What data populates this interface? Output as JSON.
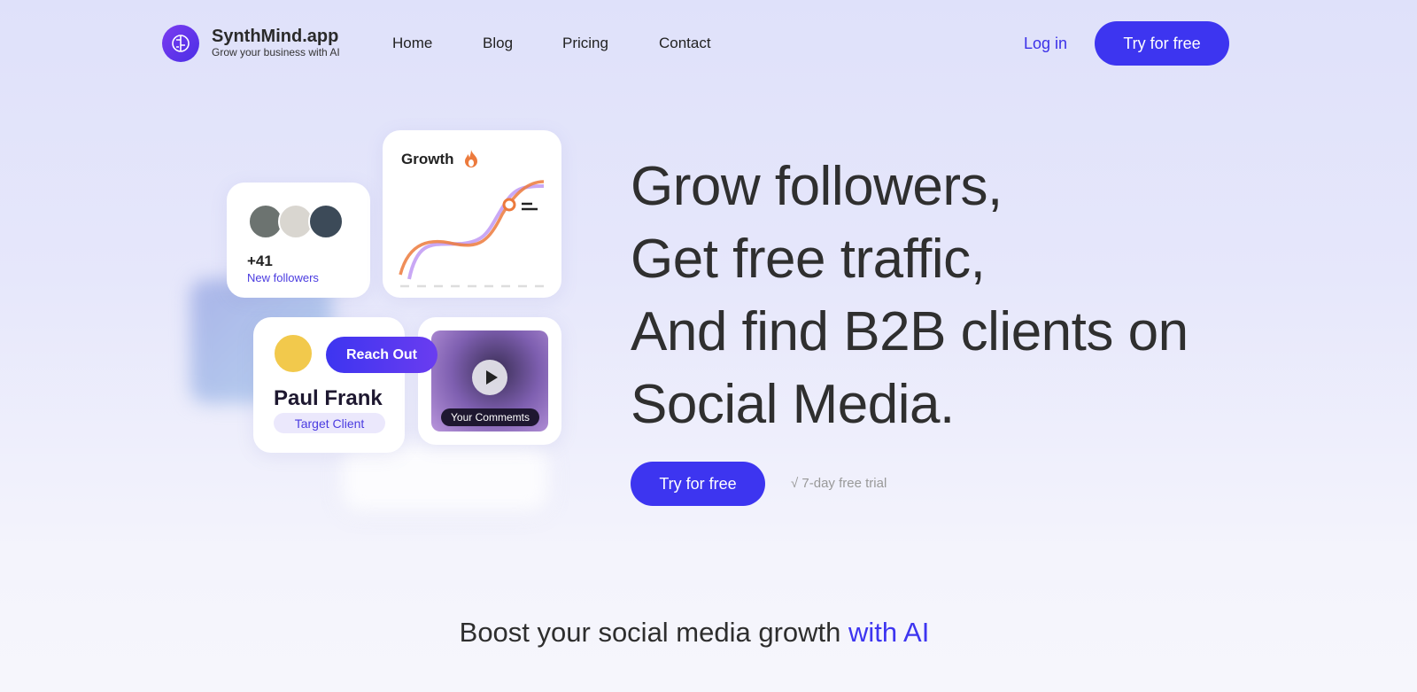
{
  "brand": {
    "name": "SynthMind.app",
    "tagline": "Grow your business with AI",
    "logo_icon": "brain-gear-icon"
  },
  "nav": {
    "items": [
      "Home",
      "Blog",
      "Pricing",
      "Contact"
    ],
    "login": "Log in",
    "cta": "Try for free"
  },
  "cards": {
    "followers": {
      "count": "+41",
      "label": "New followers"
    },
    "growth": {
      "title": "Growth",
      "icon": "fire-icon"
    },
    "client": {
      "name": "Paul Frank",
      "badge": "Target Client",
      "action": "Reach Out"
    },
    "video": {
      "label": "Your Commemts",
      "icon": "play-icon"
    }
  },
  "hero": {
    "lines": [
      "Grow followers,",
      "Get free traffic,",
      "And find B2B clients on",
      "Social Media."
    ],
    "cta": "Try for free",
    "note": "√ 7-day free trial"
  },
  "section": {
    "heading": "Boost your social media growth ",
    "heading_accent": "with AI"
  },
  "colors": {
    "accent": "#3d35f0",
    "orange": "#ec7a3c",
    "lavender": "#c9a8f5"
  }
}
